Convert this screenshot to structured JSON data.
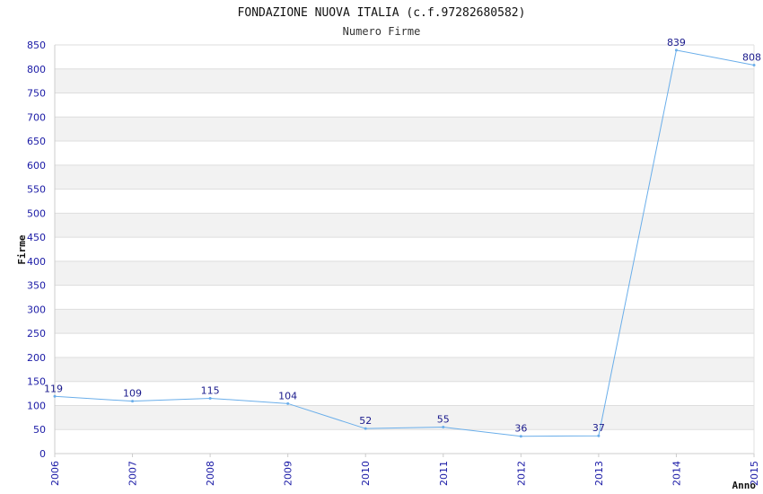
{
  "chart_data": {
    "type": "line",
    "title": "FONDAZIONE NUOVA ITALIA (c.f.97282680582)",
    "subtitle": "Numero Firme",
    "xlabel": "Anno",
    "ylabel": "Firme",
    "x": [
      "2006",
      "2007",
      "2008",
      "2009",
      "2010",
      "2011",
      "2012",
      "2013",
      "2014",
      "2015"
    ],
    "series": [
      {
        "values": [
          119,
          109,
          115,
          104,
          52,
          55,
          36,
          37,
          839,
          808
        ]
      }
    ],
    "data_labels": [
      "119",
      "109",
      "115",
      "104",
      "52",
      "55",
      "36",
      "37",
      "839",
      "808"
    ],
    "ylim": [
      0,
      850
    ],
    "yticks": [
      "0",
      "50",
      "100",
      "150",
      "200",
      "250",
      "300",
      "350",
      "400",
      "450",
      "500",
      "550",
      "600",
      "650",
      "700",
      "750",
      "800",
      "850"
    ],
    "grid": "alternating horizontal bands",
    "legend": "none",
    "colors": {
      "line": "#6aaeea",
      "band": "#f2f2f2",
      "gridline": "#dddddd",
      "tick_text": "#1a1aa6",
      "label_text": "#1a1a8c"
    }
  }
}
